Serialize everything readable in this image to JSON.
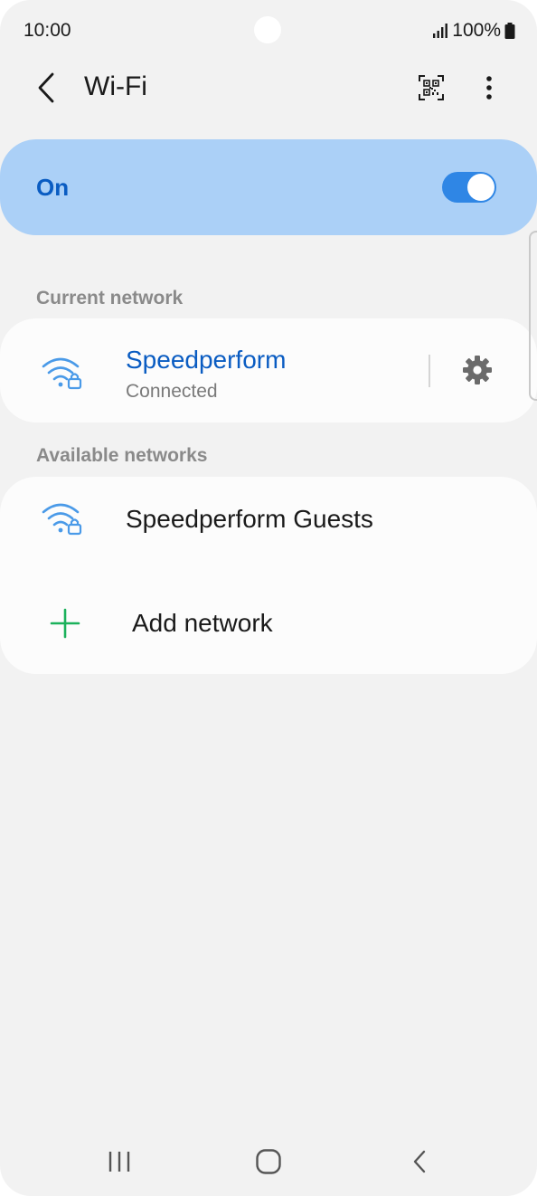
{
  "status_bar": {
    "time": "10:00",
    "battery": "100%"
  },
  "app_bar": {
    "title": "Wi-Fi",
    "back_icon": "chevron-left-icon",
    "qr_icon": "qr-code-scan-icon",
    "more_icon": "more-vertical-icon"
  },
  "master": {
    "label": "On",
    "enabled": true
  },
  "current_network": {
    "header": "Current network",
    "name": "Speedperform",
    "status": "Connected",
    "icon": "wifi-lock-icon",
    "settings_icon": "gear-icon"
  },
  "available_networks": {
    "header": "Available networks",
    "items": [
      {
        "name": "Speedperform Guests",
        "icon": "wifi-lock-icon"
      }
    ],
    "add_label": "Add network",
    "add_icon": "plus-icon"
  },
  "colors": {
    "accent": "#0a5cc2",
    "master_bg": "#abd0f7",
    "toggle_on": "#2f86e5",
    "wifi_icon": "#4a9ae8",
    "add_icon": "#1bb15b"
  }
}
